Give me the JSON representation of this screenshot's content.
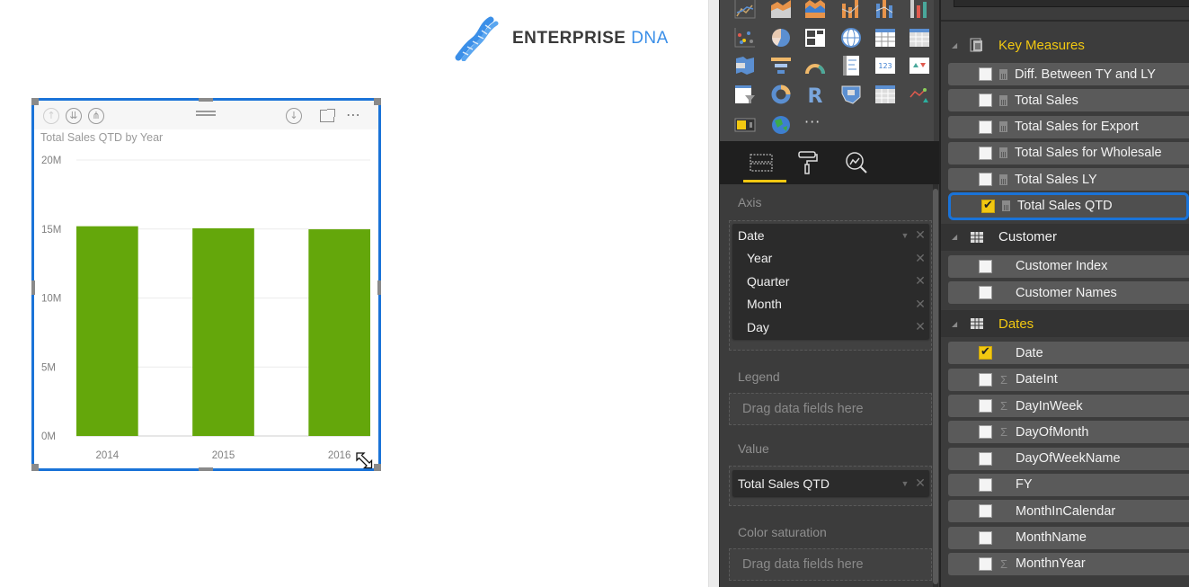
{
  "logo": {
    "brand": "ENTERPRISE",
    "brand_accent": "DNA"
  },
  "visual": {
    "title": "Total Sales QTD by Year",
    "header_icons": [
      "drill-up-icon",
      "expand-all-icon",
      "drill-down-mode-icon",
      "drill-into-icon",
      "focus-mode-icon",
      "more-options-icon"
    ],
    "more_label": "⋯"
  },
  "chart_data": {
    "type": "bar",
    "title": "Total Sales QTD by Year",
    "categories": [
      "2014",
      "2015",
      "2016"
    ],
    "series": [
      {
        "name": "Total Sales QTD",
        "values": [
          15200000,
          15050000,
          14980000
        ],
        "color": "#64a70b"
      }
    ],
    "xlabel": "",
    "ylabel": "",
    "ylim": [
      0,
      20000000
    ],
    "yticks": [
      0,
      5000000,
      10000000,
      15000000,
      20000000
    ],
    "ytick_labels": [
      "0M",
      "5M",
      "10M",
      "15M",
      "20M"
    ],
    "grid": true,
    "legend": "none"
  },
  "viz_pane": {
    "tabs": [
      {
        "name": "fields-tab",
        "active": true
      },
      {
        "name": "format-tab",
        "active": false
      },
      {
        "name": "analytics-tab",
        "active": false
      }
    ],
    "more_visuals_label": "···",
    "wells": {
      "axis": {
        "label": "Axis",
        "field": "Date",
        "hierarchy": [
          "Year",
          "Quarter",
          "Month",
          "Day"
        ]
      },
      "legend": {
        "label": "Legend",
        "placeholder": "Drag data fields here"
      },
      "value": {
        "label": "Value",
        "field": "Total Sales QTD"
      },
      "color_saturation": {
        "label": "Color saturation",
        "placeholder": "Drag data fields here"
      }
    },
    "remove_glyph": "✕",
    "dropdown_glyph": "▼"
  },
  "fields_pane": {
    "tables": [
      {
        "name": "Key Measures",
        "highlighted": true,
        "fields": [
          {
            "label": "Diff. Between TY and LY",
            "type": "measure",
            "checked": false
          },
          {
            "label": "Total Sales",
            "type": "measure",
            "checked": false
          },
          {
            "label": "Total Sales for Export",
            "type": "measure",
            "checked": false
          },
          {
            "label": "Total Sales for Wholesale",
            "type": "measure",
            "checked": false
          },
          {
            "label": "Total Sales LY",
            "type": "measure",
            "checked": false
          },
          {
            "label": "Total Sales QTD",
            "type": "measure",
            "checked": true,
            "selected": true
          }
        ]
      },
      {
        "name": "Customer",
        "highlighted": false,
        "fields": [
          {
            "label": "Customer Index",
            "type": "text",
            "checked": false
          },
          {
            "label": "Customer Names",
            "type": "text",
            "checked": false
          }
        ]
      },
      {
        "name": "Dates",
        "highlighted": true,
        "fields": [
          {
            "label": "Date",
            "type": "text",
            "checked": true
          },
          {
            "label": "DateInt",
            "type": "sum",
            "checked": false
          },
          {
            "label": "DayInWeek",
            "type": "sum",
            "checked": false
          },
          {
            "label": "DayOfMonth",
            "type": "sum",
            "checked": false
          },
          {
            "label": "DayOfWeekName",
            "type": "text",
            "checked": false
          },
          {
            "label": "FY",
            "type": "text",
            "checked": false
          },
          {
            "label": "MonthInCalendar",
            "type": "text",
            "checked": false
          },
          {
            "label": "MonthName",
            "type": "text",
            "checked": false
          },
          {
            "label": "MonthnYear",
            "type": "sum",
            "checked": false
          }
        ]
      }
    ],
    "sum_glyph": "Σ",
    "collapse_glyph": "◢",
    "highlight_color": "#f2c811"
  }
}
